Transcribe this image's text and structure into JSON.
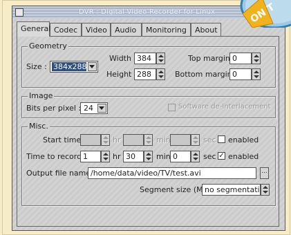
{
  "window": {
    "title": "DVR : Digital Video Recorder for Linux"
  },
  "badge": {
    "text": "ON T"
  },
  "tabs": [
    {
      "label": "General",
      "active": true
    },
    {
      "label": "Codec",
      "active": false
    },
    {
      "label": "Video",
      "active": false
    },
    {
      "label": "Audio",
      "active": false
    },
    {
      "label": "Monitoring",
      "active": false
    },
    {
      "label": "About",
      "active": false
    }
  ],
  "geometry": {
    "legend": "Geometry",
    "size_label": "Size :",
    "size_value": "384x288",
    "width_label": "Width :",
    "width_value": "384",
    "height_label": "Height :",
    "height_value": "288",
    "top_margin_label": "Top margin :",
    "top_margin_value": "0",
    "bottom_margin_label": "Bottom margin :",
    "bottom_margin_value": "0"
  },
  "image": {
    "legend": "Image",
    "bpp_label": "Bits per pixel :",
    "bpp_value": "24",
    "deinterlace_label": "Software de-Interlacement",
    "deinterlace_checked": false,
    "deinterlace_enabled": false
  },
  "misc": {
    "legend": "Misc.",
    "start_time_label": "Start time :",
    "start_hr": "",
    "start_min": "",
    "start_sec": "",
    "start_enabled_label": "enabled",
    "start_enabled_checked": false,
    "time_to_record_label": "Time to record :",
    "record_hr": "1",
    "record_min": "30",
    "record_sec": "0",
    "record_enabled_label": "enabled",
    "record_enabled_checked": true,
    "hr_unit": "hr",
    "min_unit": "min",
    "sec_unit": "sec",
    "output_label": "Output file name :",
    "output_value": "/home/data/video/TV/test.avi",
    "browse_label": "...",
    "segment_label": "Segment size (Mo) :",
    "segment_value": "no segmentation"
  },
  "colors": {
    "page_background": "#f6ecc8",
    "window_gray": "#cfcfcf",
    "selection": "#2f4f7f",
    "titlebar": "#a9b4c7"
  }
}
